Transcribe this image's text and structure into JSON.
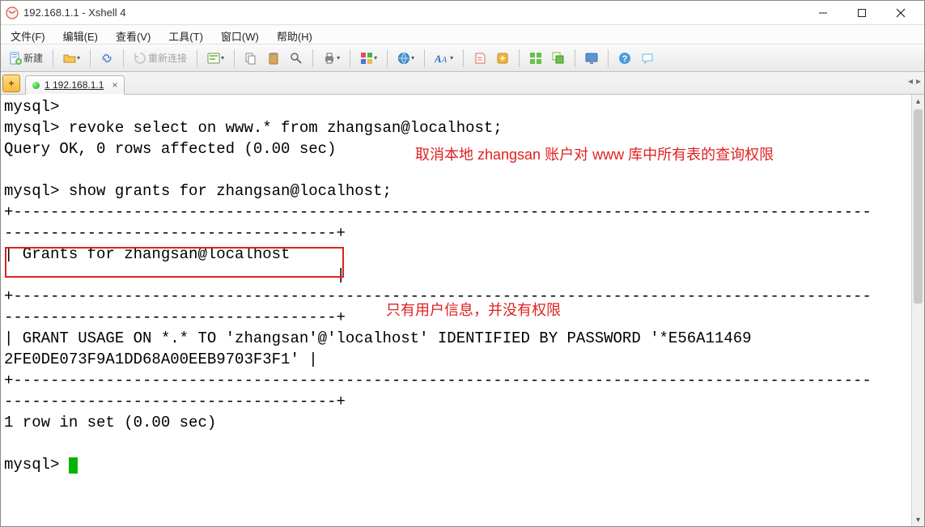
{
  "title": "192.168.1.1 - Xshell 4",
  "menu": {
    "file": "文件(F)",
    "edit": "编辑(E)",
    "view": "查看(V)",
    "tools": "工具(T)",
    "window": "窗口(W)",
    "help": "帮助(H)"
  },
  "toolbar": {
    "new_label": "新建",
    "reconnect_label": "重新连接"
  },
  "tab": {
    "label": "1 192.168.1.1"
  },
  "terminal": {
    "line1": "mysql>",
    "line2": "mysql> revoke select on www.* from zhangsan@localhost;",
    "line3": "Query OK, 0 rows affected (0.00 sec)",
    "line4": "",
    "line5": "mysql> show grants for zhangsan@localhost;",
    "line6": "+---------------------------------------------------------------------------------------------",
    "line7": "------------------------------------+",
    "line8": "| Grants for zhangsan@localhost                                                                   ",
    "line9": "                                    |",
    "line10": "+---------------------------------------------------------------------------------------------",
    "line11": "------------------------------------+",
    "line12": "| GRANT USAGE ON *.* TO 'zhangsan'@'localhost' IDENTIFIED BY PASSWORD '*E56A11469",
    "line13": "2FE0DE073F9A1DD68A00EEB9703F3F1' |",
    "line14": "+---------------------------------------------------------------------------------------------",
    "line15": "------------------------------------+",
    "line16": "1 row in set (0.00 sec)",
    "line17": "",
    "line18": "mysql> "
  },
  "annotations": {
    "a1": "取消本地 zhangsan 账户对 www 库中所有表的查询权限",
    "a2": "只有用户信息，并没有权限"
  }
}
